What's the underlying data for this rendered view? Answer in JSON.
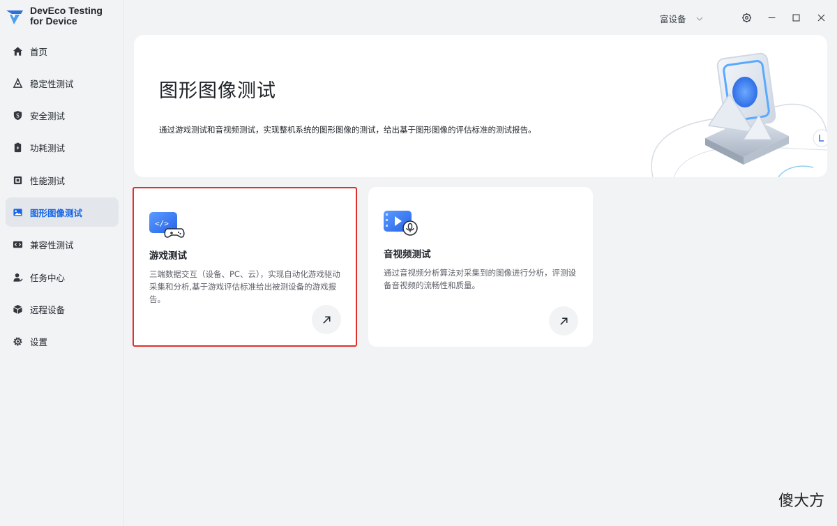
{
  "app": {
    "title_line1": "DevEco Testing",
    "title_line2": "for Device"
  },
  "sidebar": {
    "items": [
      {
        "label": "首页",
        "icon": "home-icon"
      },
      {
        "label": "稳定性测试",
        "icon": "stability-icon"
      },
      {
        "label": "安全测试",
        "icon": "security-shield-icon"
      },
      {
        "label": "功耗测试",
        "icon": "power-icon"
      },
      {
        "label": "性能测试",
        "icon": "performance-icon"
      },
      {
        "label": "图形图像测试",
        "icon": "image-icon",
        "active": true
      },
      {
        "label": "兼容性测试",
        "icon": "compatibility-icon"
      },
      {
        "label": "任务中心",
        "icon": "task-center-icon"
      },
      {
        "label": "远程设备",
        "icon": "remote-device-icon"
      },
      {
        "label": "设置",
        "icon": "settings-icon"
      }
    ]
  },
  "topbar": {
    "device_label": "富设备"
  },
  "banner": {
    "title": "图形图像测试",
    "description": "通过游戏测试和音视频测试，实现整机系统的图形图像的测试，给出基于图形图像的评估标准的测试报告。"
  },
  "cards": [
    {
      "title": "游戏测试",
      "description": "三端数据交互（设备、PC、云），实现自动化游戏驱动采集和分析,基于游戏评估标准给出被测设备的游戏报告。",
      "icon": "game-test-icon"
    },
    {
      "title": "音视频测试",
      "description": "通过音视频分析算法对采集到的图像进行分析，评测设备音视频的流畅性和质量。",
      "icon": "audio-video-test-icon"
    }
  ],
  "watermark": "傻大方",
  "colors": {
    "accent": "#1565e6",
    "selection_border": "#e0302b",
    "background": "#f1f3f5"
  }
}
